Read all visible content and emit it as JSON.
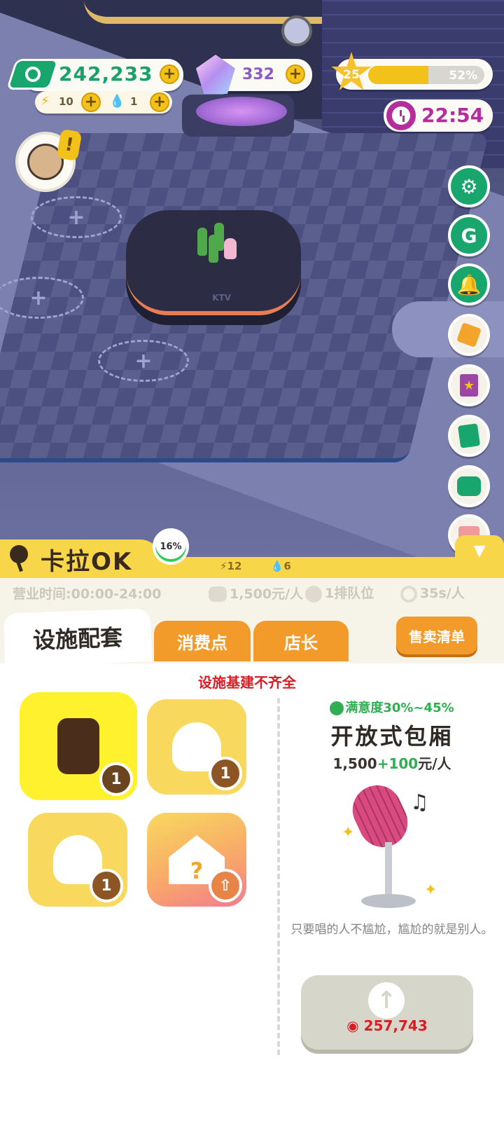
{
  "hud": {
    "cash": "242,233",
    "energy": "10",
    "water": "1",
    "gems": "332",
    "level": "25",
    "xp_percent_label": "52%",
    "xp_fraction": 0.52,
    "timer": "22:54"
  },
  "scene": {
    "table_label": "KTV"
  },
  "panel": {
    "shop_name": "卡拉OK",
    "progress": "16%",
    "mini_energy": "12",
    "mini_water": "6",
    "hours": "营业时间:00:00-24:00",
    "price": "1,500元/人",
    "queue": "1排队位",
    "speed": "35s/人",
    "tabs": {
      "active": "设施配套",
      "consume": "消费点",
      "manager": "店长"
    },
    "sell_list": "售卖清单",
    "warning": "设施基建不齐全"
  },
  "facilities": [
    {
      "name": "mic-stand",
      "level": "1"
    },
    {
      "name": "service-staff",
      "level": "1"
    },
    {
      "name": "audience",
      "level": "1"
    },
    {
      "name": "mystery-room",
      "level": ""
    }
  ],
  "detail": {
    "satisfaction": "满意度30%~45%",
    "title": "开放式包厢",
    "price_base": "1,500",
    "price_bonus": "+100",
    "price_unit": "元/人",
    "quote": "只要唱的人不尴尬，尴尬的就是别人。",
    "upgrade_cost": "257,743"
  },
  "colors": {
    "accent_green": "#19a66e",
    "accent_yellow": "#f7d64a",
    "accent_orange": "#f29a2a",
    "warning_red": "#d81d24",
    "timer_purple": "#b52d9c"
  },
  "icons": [
    "cash-icon",
    "gem-icon",
    "star-icon",
    "clock-icon",
    "gear-icon",
    "g-coin-icon",
    "bell-icon",
    "mystery-box-icon",
    "star-book-icon",
    "notes-icon",
    "chat-icon",
    "gift-icon",
    "collapse-arrow-icon",
    "upgrade-arrow-icon"
  ]
}
